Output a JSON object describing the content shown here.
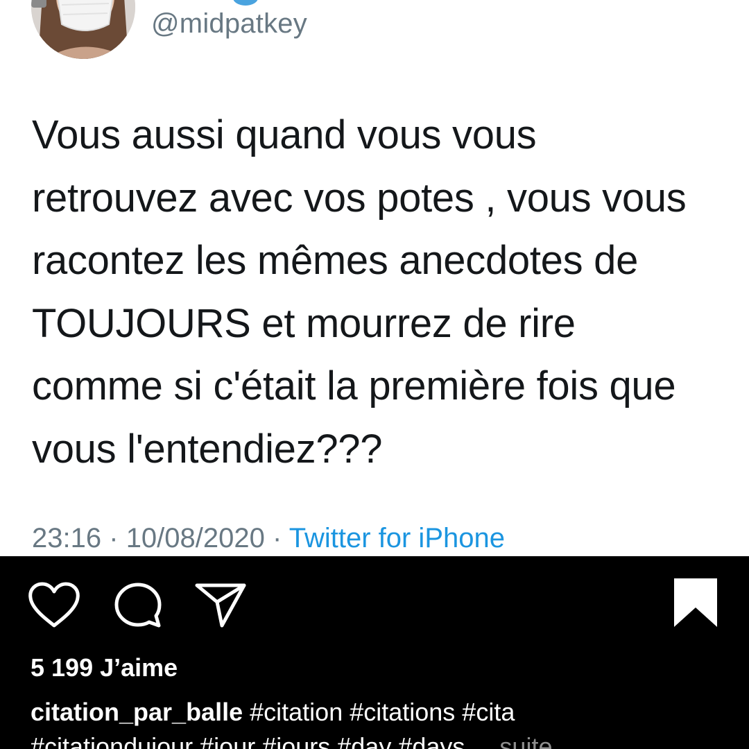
{
  "tweet": {
    "handle": "@midpatkey",
    "text_lines": [
      "Vous aussi quand vous vous",
      "retrouvez avec vos potes , vous vous",
      "racontez les mêmes anecdotes de",
      "TOUJOURS et mourrez de rire",
      "comme si c'était la première fois que",
      "vous l'entendiez???"
    ],
    "time": "23:16",
    "date": "10/08/2020",
    "separator": "·",
    "source": "Twitter for iPhone"
  },
  "instagram": {
    "icons": [
      "heart-icon",
      "comment-icon",
      "share-icon",
      "bookmark-icon"
    ],
    "likes": "5 199 J’aime",
    "caption_username": "citation_par_balle",
    "caption_line1": "#citation #citations #cita",
    "caption_line2": "#citationdujour #jour #jours #day #days",
    "caption_more": "... suite"
  },
  "colors": {
    "tweet_text": "#14171a",
    "tweet_meta": "#687883",
    "twitter_link": "#1b95e0",
    "ig_background": "#000000",
    "ig_text": "#ffffff"
  }
}
